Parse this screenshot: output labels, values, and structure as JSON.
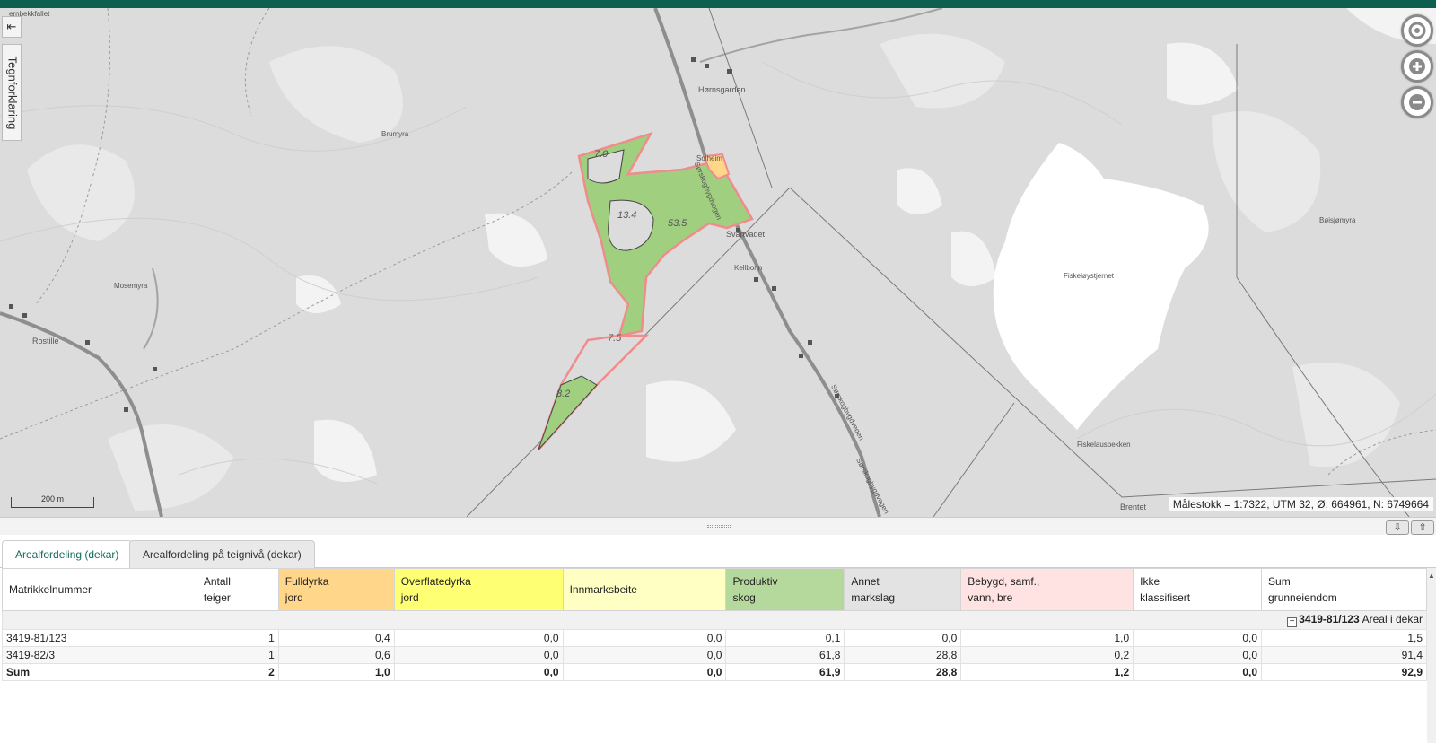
{
  "app": {
    "accent_color": "#0d5f4f"
  },
  "map": {
    "side_button_icon": "collapse-left-icon",
    "side_button_glyph": "⇤",
    "legend_tab_label": "Tegnforklaring",
    "place_names": {
      "top_left": "ernbekkfallet",
      "hornsgarden": "Hørnsgarden",
      "brumyra": "Brumyra",
      "mosemyra": "Mosemyra",
      "rostille": "Rostille",
      "svartvadet": "Svartvadet",
      "kellbonn": "Kellbonn",
      "fiskeloystjernet": "Fiskeløystjernet",
      "boisjomyra": "Bøisjømyra",
      "fiskelausbekken": "Fiskelausbekken",
      "brentet": "Brentet",
      "sorskogbygdvegen_1": "Sørskogbygdvegen",
      "sorskogbygdvegen_2": "Sørskogbygdvegen",
      "sorskogbygdvegen_3": "Sørskogbygdvegen",
      "solheim": "Solheim"
    },
    "parcel_labels": {
      "a": "7.0",
      "b": "13.4",
      "c": "53.5",
      "d": "7.5",
      "e": "8.2"
    },
    "controls": [
      {
        "name": "locate-icon"
      },
      {
        "name": "zoom-in-icon"
      },
      {
        "name": "zoom-out-icon"
      }
    ],
    "scalebar_label": "200 m",
    "scale_info": "Målestokk = 1:7322, UTM 32, Ø: 664961, N: 6749664",
    "colors": {
      "productive_forest": "#9fcf7f",
      "parcel_outline": "#f08c8c",
      "water": "#ffffff",
      "terrain": "#dcdcdc"
    }
  },
  "panel": {
    "expand_down_glyph": "⇩",
    "expand_up_glyph": "⇧",
    "tabs": [
      {
        "label": "Arealfordeling (dekar)",
        "active": true
      },
      {
        "label": "Arealfordeling på teignivå (dekar)",
        "active": false
      }
    ],
    "columns": [
      {
        "line1": "Matrikkelnummer",
        "line2": "",
        "color": "#ffffff"
      },
      {
        "line1": "Antall",
        "line2": "teiger",
        "color": "#ffffff"
      },
      {
        "line1": "Fulldyrka",
        "line2": "jord",
        "color": "#ffd68a"
      },
      {
        "line1": "Overflatedyrka",
        "line2": "jord",
        "color": "#ffff73"
      },
      {
        "line1": "Innmarksbeite",
        "line2": "",
        "color": "#ffffc3"
      },
      {
        "line1": "Produktiv",
        "line2": "skog",
        "color": "#b5d99c"
      },
      {
        "line1": "Annet",
        "line2": "markslag",
        "color": "#e3e3e3"
      },
      {
        "line1": "Bebygd, samf.,",
        "line2": "vann, bre",
        "color": "#ffe2e2"
      },
      {
        "line1": "Ikke",
        "line2": "klassifisert",
        "color": "#ffffff"
      },
      {
        "line1": "Sum",
        "line2": "grunneiendom",
        "color": "#ffffff"
      }
    ],
    "group": {
      "collapse_glyph": "−",
      "id": "3419-81/123",
      "label": "Areal i dekar"
    },
    "rows": [
      {
        "cells": [
          "3419-81/123",
          "1",
          "0,4",
          "0,0",
          "0,0",
          "0,1",
          "0,0",
          "1,0",
          "0,0",
          "1,5"
        ]
      },
      {
        "cells": [
          "3419-82/3",
          "1",
          "0,6",
          "0,0",
          "0,0",
          "61,8",
          "28,8",
          "0,2",
          "0,0",
          "91,4"
        ]
      }
    ],
    "sum": {
      "cells": [
        "Sum",
        "2",
        "1,0",
        "0,0",
        "0,0",
        "61,9",
        "28,8",
        "1,2",
        "0,0",
        "92,9"
      ]
    },
    "scroll_glyph": "▲"
  }
}
